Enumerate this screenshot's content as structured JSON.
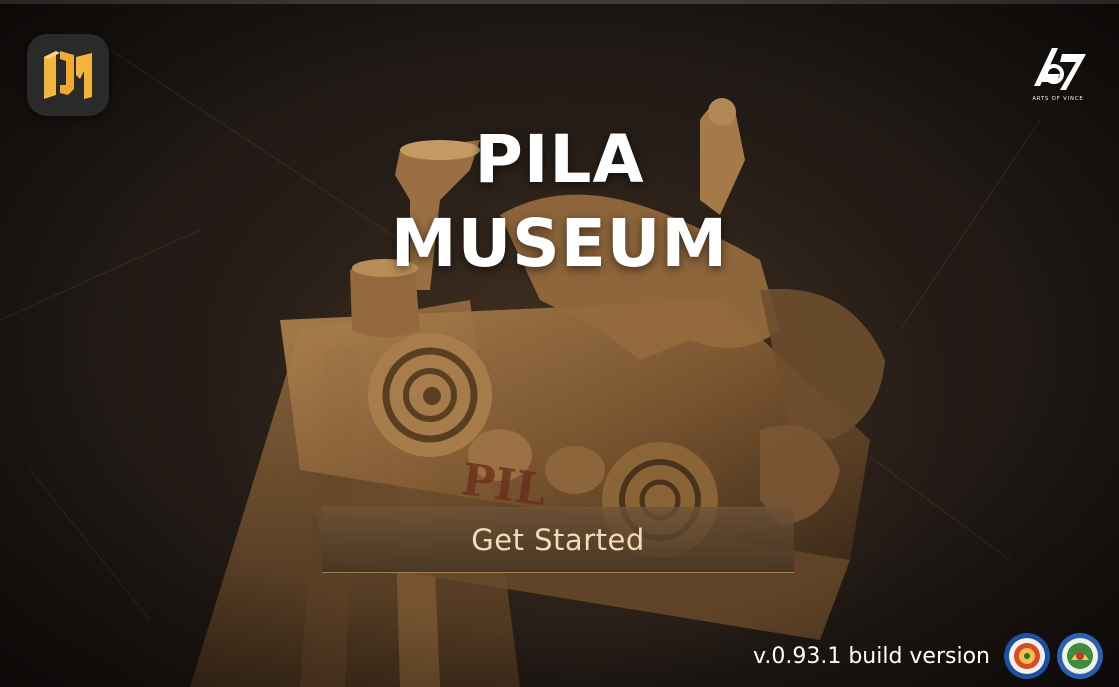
{
  "app": {
    "title_line1": "PILA",
    "title_line2": "MUSEUM"
  },
  "icons": {
    "app_icon": "app-logo-icon",
    "brand_logo": "arts-of-vince-logo",
    "seal_left": "municipal-seal-icon",
    "seal_right": "heritage-seal-icon"
  },
  "brand": {
    "logo_caption": "ARTS OF VINCE"
  },
  "cta": {
    "label": "Get Started"
  },
  "footer": {
    "version": "v.0.93.1 build version"
  },
  "colors": {
    "accent_gold": "#f0b43a",
    "button_text": "#f3dab8",
    "title": "#ffffff",
    "background": "#1e1712"
  }
}
